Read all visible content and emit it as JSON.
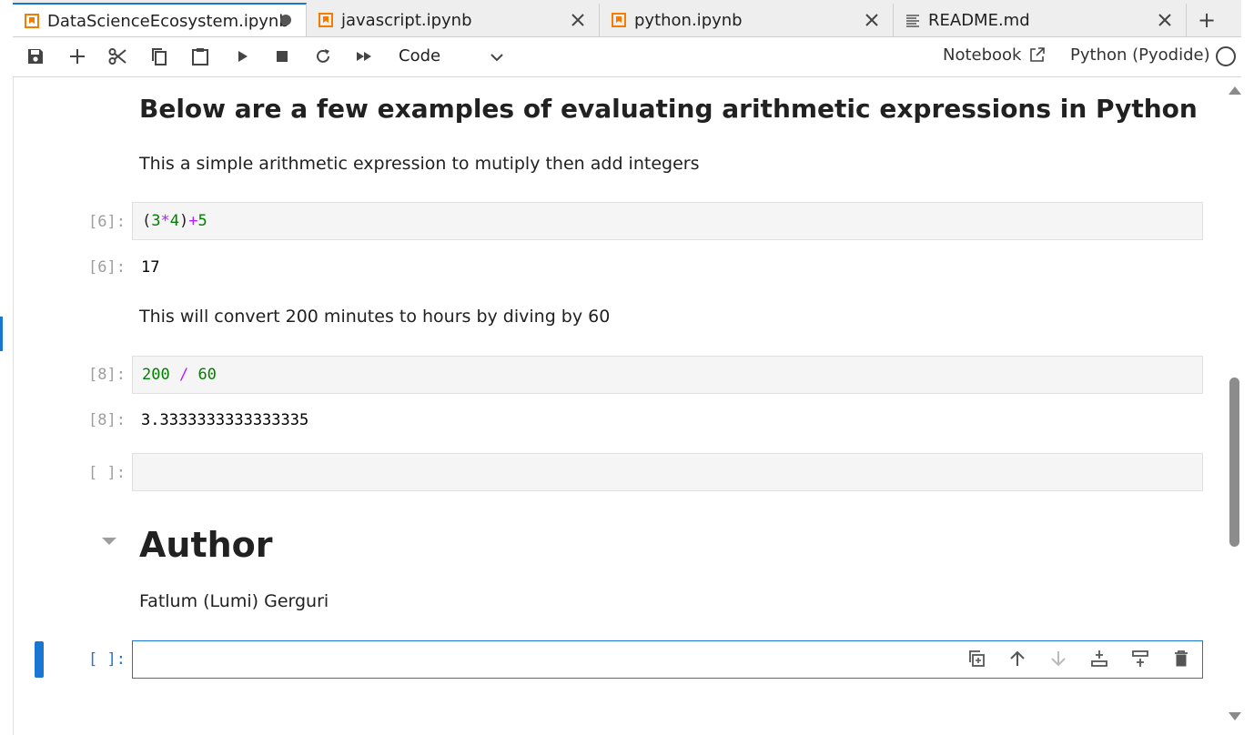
{
  "tabs": [
    {
      "label": "DataScienceEcosystem.ipynb",
      "kind": "notebook",
      "modified": true,
      "active": true
    },
    {
      "label": "javascript.ipynb",
      "kind": "notebook",
      "modified": false,
      "active": false
    },
    {
      "label": "python.ipynb",
      "kind": "notebook",
      "modified": false,
      "active": false
    },
    {
      "label": "README.md",
      "kind": "markdown",
      "modified": false,
      "active": false
    }
  ],
  "new_tab_label": "+",
  "toolbar": {
    "cell_type": "Code",
    "notebook_link": "Notebook",
    "kernel": "Python (Pyodide)"
  },
  "notebook": {
    "heading": "Below are a few examples of evaluating arithmetic expressions in Python",
    "para1": "This a simple arithmetic expression to mutiply then add integers",
    "cell1": {
      "in_prompt": "[6]:",
      "code_parts": [
        "(",
        "3",
        "*",
        "4",
        ")",
        "+",
        "5"
      ],
      "out_prompt": "[6]:",
      "output": "17"
    },
    "para2": "This will convert 200 minutes to hours by diving by 60",
    "cell2": {
      "in_prompt": "[8]:",
      "code_parts": [
        "200",
        " / ",
        "60"
      ],
      "out_prompt": "[8]:",
      "output": "3.3333333333333335"
    },
    "cell3": {
      "in_prompt": "[ ]:"
    },
    "author_heading": "Author",
    "author_name": "Fatlum (Lumi) Gerguri",
    "cell4": {
      "in_prompt": "[ ]:"
    }
  },
  "colors": {
    "accent": "#1976d2",
    "notebook_icon": "#f57c00",
    "number": "#008000",
    "operator": "#aa22ff"
  }
}
